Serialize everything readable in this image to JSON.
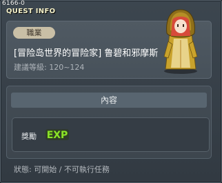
{
  "header": {
    "quest_id": "6166-0",
    "title": "QUEST INFO"
  },
  "quest": {
    "job_tag": "職業",
    "name": "[冒险岛世界的冒险家] 鲁碧和邪摩斯",
    "level_range": "建議等級: 120~124"
  },
  "content": {
    "section_title": "內容",
    "reward_label": "獎勵",
    "reward_badge": "EXP"
  },
  "footer": {
    "status": "狀態: 可開始 / 不可執行任務"
  },
  "colors": {
    "accent_exp_green": "#8ce22a",
    "tag_bg": "#c9bfa6"
  }
}
